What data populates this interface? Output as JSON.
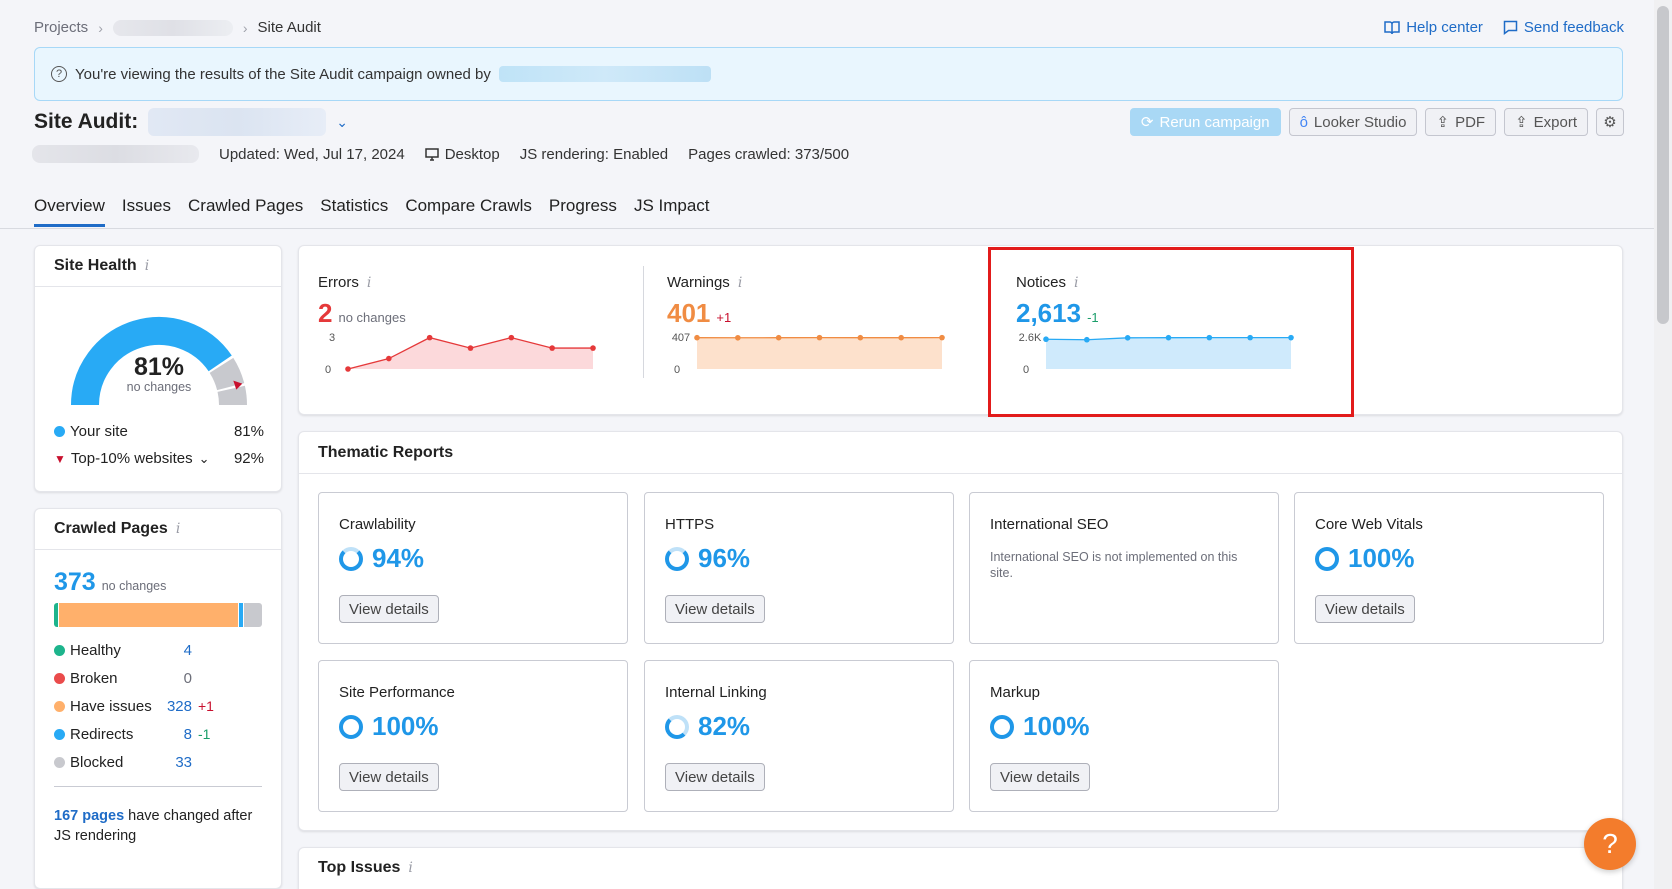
{
  "breadcrumb": {
    "projects": "Projects",
    "current": "Site Audit"
  },
  "top_links": {
    "help": "Help center",
    "feedback": "Send feedback"
  },
  "notice": {
    "text": "You're viewing the results of the Site Audit campaign owned by"
  },
  "header": {
    "title": "Site Audit:",
    "updated": "Updated: Wed, Jul 17, 2024",
    "device": "Desktop",
    "js_rendering": "JS rendering: Enabled",
    "pages_crawled": "Pages crawled: 373/500"
  },
  "actions": {
    "rerun": "Rerun campaign",
    "looker": "Looker Studio",
    "pdf": "PDF",
    "export": "Export"
  },
  "tabs": [
    "Overview",
    "Issues",
    "Crawled Pages",
    "Statistics",
    "Compare Crawls",
    "Progress",
    "JS Impact"
  ],
  "site_health": {
    "title": "Site Health",
    "value": "81%",
    "sub": "no changes",
    "your_site_label": "Your site",
    "your_site_value": "81%",
    "top10_label": "Top-10% websites",
    "top10_value": "92%",
    "score_fraction": 0.81,
    "top10_fraction": 0.92,
    "colors": {
      "main": "#28aaf5",
      "rest": "#c8c9ce",
      "marker": "#c8102e"
    }
  },
  "crawled_pages": {
    "title": "Crawled Pages",
    "total": "373",
    "sub": "no changes",
    "rows": [
      {
        "name": "Healthy",
        "value": "4",
        "delta": "",
        "color": "#1db48c"
      },
      {
        "name": "Broken",
        "value": "0",
        "delta": "",
        "color": "#ea4b4b"
      },
      {
        "name": "Have issues",
        "value": "328",
        "delta": "+1",
        "color": "#ffb06b"
      },
      {
        "name": "Redirects",
        "value": "8",
        "delta": "-1",
        "color": "#28aaf5"
      },
      {
        "name": "Blocked",
        "value": "33",
        "delta": "",
        "color": "#c8c9ce"
      }
    ],
    "js_note_link": "167 pages",
    "js_note_text": "have changed after JS rendering"
  },
  "stats": {
    "errors": {
      "label": "Errors",
      "value": "2",
      "change": "no changes",
      "ymax": "3",
      "ymin": "0",
      "points": [
        0,
        1,
        3,
        2,
        3,
        2,
        2
      ],
      "color": "#e5393a",
      "fill": "#fcd9db"
    },
    "warnings": {
      "label": "Warnings",
      "value": "401",
      "change": "+1",
      "ymax": "407",
      "ymin": "0",
      "points": [
        400,
        399,
        400,
        401,
        400,
        400,
        401
      ],
      "color": "#f08c43",
      "fill": "#fde1cc"
    },
    "notices": {
      "label": "Notices",
      "value": "2,613",
      "change": "-1",
      "ymax": "2.6K",
      "ymin": "0",
      "points": [
        2480,
        2440,
        2600,
        2610,
        2614,
        2614,
        2613
      ],
      "color": "#28aaf5",
      "fill": "#cfeafc"
    }
  },
  "thematic": {
    "title": "Thematic Reports",
    "view_details": "View details",
    "cards": [
      {
        "name": "Crawlability",
        "pct": "94%"
      },
      {
        "name": "HTTPS",
        "pct": "96%"
      },
      {
        "name": "International SEO",
        "note": "International SEO is not implemented on this site."
      },
      {
        "name": "Core Web Vitals",
        "pct": "100%"
      },
      {
        "name": "Site Performance",
        "pct": "100%"
      },
      {
        "name": "Internal Linking",
        "pct": "82%"
      },
      {
        "name": "Markup",
        "pct": "100%"
      }
    ]
  },
  "top_issues": {
    "title": "Top Issues"
  }
}
